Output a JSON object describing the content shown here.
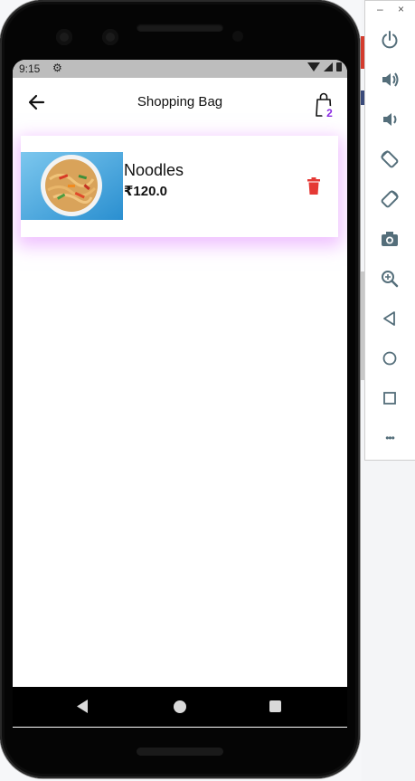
{
  "status_bar": {
    "time": "9:15"
  },
  "app_bar": {
    "title": "Shopping Bag",
    "bag_count": "2"
  },
  "cart_items": [
    {
      "name": "Noodles",
      "price": "₹120.0"
    }
  ],
  "emulator_panel": {
    "minimize_label": "–",
    "close_label": "×",
    "more_label": "•••"
  },
  "colors": {
    "badge": "#8a2be2",
    "delete_icon": "#e53935",
    "card_glow": "#e28cff",
    "panel_icons": "#546e7a"
  }
}
